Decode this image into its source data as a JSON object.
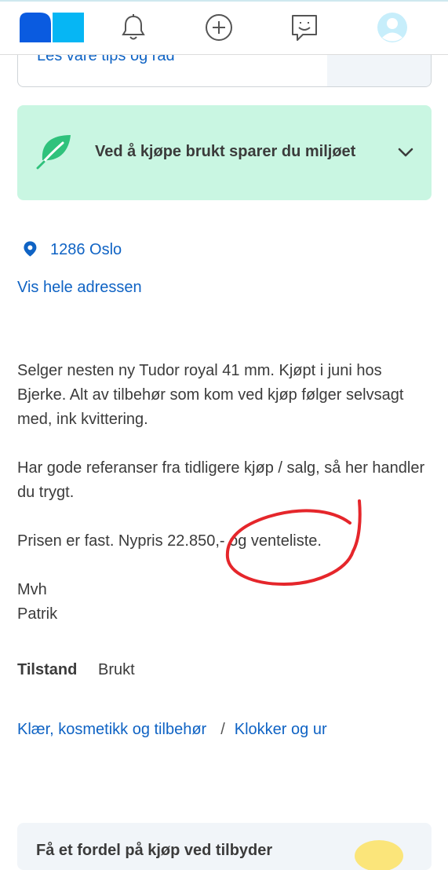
{
  "nav": {
    "icons": [
      "logo",
      "bell-icon",
      "add-circle-icon",
      "chat-icon",
      "profile-icon"
    ]
  },
  "tips": {
    "link": "Les våre tips og råd"
  },
  "eco": {
    "title": "Ved å kjøpe brukt sparer du miljøet"
  },
  "location": {
    "postal": "1286 Oslo",
    "show_address": "Vis hele adressen"
  },
  "description": {
    "paragraphs": [
      "Selger nesten ny Tudor royal 41 mm. Kjøpt i juni hos Bjerke. Alt av tilbehør som kom ved kjøp følger selvsagt med, ink kvittering.",
      "Har gode referanser fra tidligere kjøp / salg, så her handler du trygt.",
      "Prisen er fast. Nypris 22.850,- og venteliste.",
      "Mvh\nPatrik"
    ]
  },
  "condition": {
    "label": "Tilstand",
    "value": "Brukt"
  },
  "breadcrumbs": {
    "first": "Klær, kosmetikk og tilbehør",
    "separator": "/",
    "second": "Klokker og ur"
  },
  "bottom_card": {
    "text": "Få et fordel på kjøp ved tilbyder"
  },
  "colors": {
    "link": "#0f63c4",
    "eco_bg": "#c9f6e2",
    "annotation": "#e5262b"
  }
}
